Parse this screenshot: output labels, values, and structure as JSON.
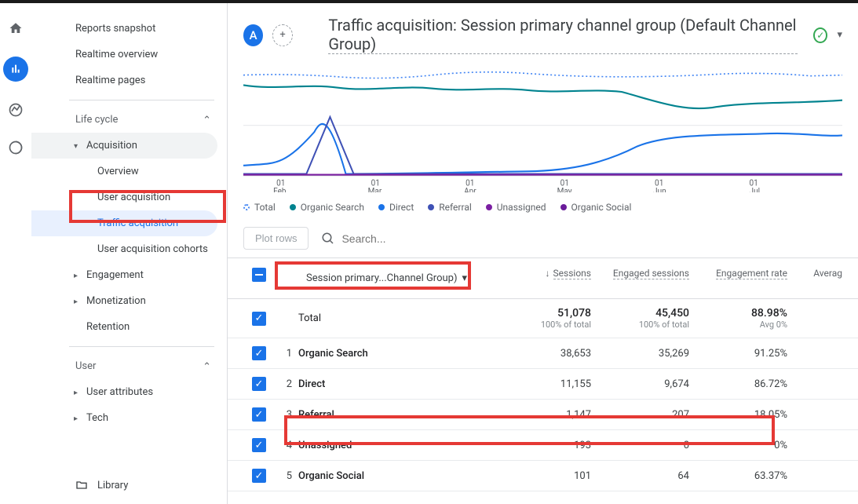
{
  "sidebar": {
    "items": [
      {
        "label": "Reports snapshot"
      },
      {
        "label": "Realtime overview"
      },
      {
        "label": "Realtime pages"
      }
    ],
    "lifecycle_label": "Life cycle",
    "acquisition": {
      "label": "Acquisition",
      "items": [
        {
          "label": "Overview"
        },
        {
          "label": "User acquisition"
        },
        {
          "label": "Traffic acquisition"
        },
        {
          "label": "User acquisition cohorts"
        }
      ]
    },
    "engagement_label": "Engagement",
    "monetization_label": "Monetization",
    "retention_label": "Retention",
    "user_label": "User",
    "user_attributes_label": "User attributes",
    "tech_label": "Tech",
    "library_label": "Library"
  },
  "header": {
    "avatar_letter": "A",
    "title": "Traffic acquisition: Session primary channel group (Default Channel Group)"
  },
  "legend": {
    "total": "Total",
    "organic_search": "Organic Search",
    "direct": "Direct",
    "referral": "Referral",
    "unassigned": "Unassigned",
    "organic_social": "Organic Social"
  },
  "toolbar": {
    "plot_rows": "Plot rows",
    "search_placeholder": "Search..."
  },
  "table": {
    "dimension_label": "Session primary...Channel Group)",
    "columns": {
      "sessions": "Sessions",
      "engaged_sessions": "Engaged sessions",
      "engagement_rate": "Engagement rate",
      "average": "Averag"
    },
    "totals": {
      "label": "Total",
      "sessions": "51,078",
      "sessions_sub": "100% of total",
      "engaged": "45,450",
      "engaged_sub": "100% of total",
      "rate": "88.98%",
      "rate_sub": "Avg 0%"
    },
    "rows": [
      {
        "idx": "1",
        "name": "Organic Search",
        "sessions": "38,653",
        "engaged": "35,269",
        "rate": "91.25%"
      },
      {
        "idx": "2",
        "name": "Direct",
        "sessions": "11,155",
        "engaged": "9,674",
        "rate": "86.72%"
      },
      {
        "idx": "3",
        "name": "Referral",
        "sessions": "1,147",
        "engaged": "207",
        "rate": "18.05%"
      },
      {
        "idx": "4",
        "name": "Unassigned",
        "sessions": "193",
        "engaged": "0",
        "rate": "0%"
      },
      {
        "idx": "5",
        "name": "Organic Social",
        "sessions": "101",
        "engaged": "64",
        "rate": "63.37%"
      }
    ]
  },
  "chart_data": {
    "type": "line",
    "xlabel": "",
    "ylabel": "",
    "x_ticks": [
      "01 Feb",
      "01 Mar",
      "01 Apr",
      "01 May",
      "01 Jun",
      "01 Jul"
    ],
    "series": [
      {
        "name": "Total",
        "style": "dotted",
        "color": "#4285f4",
        "values": [
          320,
          310,
          330,
          325,
          340,
          315,
          330
        ]
      },
      {
        "name": "Organic Search",
        "color": "#00838f",
        "values": [
          280,
          260,
          270,
          255,
          265,
          200,
          230
        ]
      },
      {
        "name": "Direct",
        "color": "#1a73e8",
        "values": [
          55,
          60,
          45,
          50,
          55,
          120,
          140
        ]
      },
      {
        "name": "Referral",
        "color": "#3f51b5",
        "values": [
          5,
          120,
          5,
          5,
          5,
          5,
          5
        ]
      },
      {
        "name": "Unassigned",
        "color": "#7b1fa2",
        "values": [
          2,
          2,
          2,
          2,
          2,
          2,
          2
        ]
      },
      {
        "name": "Organic Social",
        "color": "#6a1b9a",
        "values": [
          1,
          1,
          1,
          1,
          1,
          1,
          1
        ]
      }
    ]
  }
}
